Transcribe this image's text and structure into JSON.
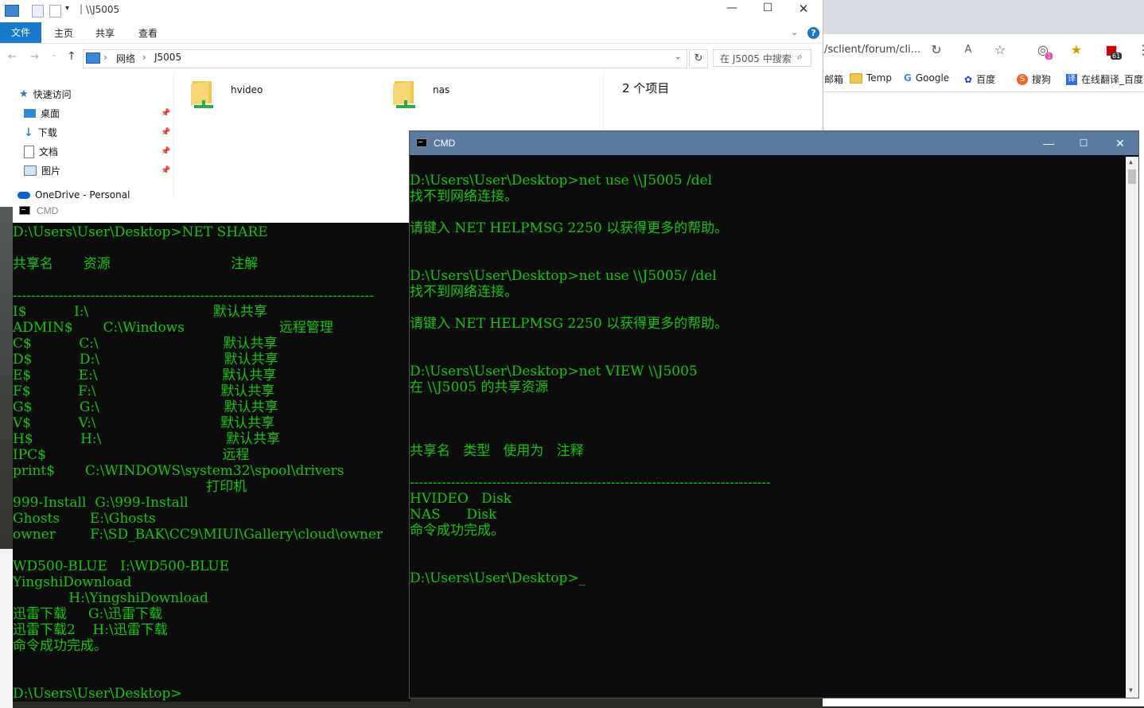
{
  "explorer": {
    "title": "\\\\J5005",
    "ribbon_tabs": [
      "文件",
      "主页",
      "共享",
      "查看"
    ],
    "breadcrumb": [
      "网络",
      "J5005"
    ],
    "search_placeholder": "在 J5005 中搜索",
    "sidebar": {
      "quick_access": "快速访问",
      "items": [
        "桌面",
        "下载",
        "文档",
        "图片"
      ],
      "onedrive": "OneDrive - Personal"
    },
    "folders": [
      "hvideo",
      "nas"
    ],
    "item_count": "2 个项目"
  },
  "browser": {
    "url": "/sclient/forum/cli...",
    "bookmarks": [
      "邮箱",
      "Temp",
      "Google",
      "百度",
      "搜狗",
      "在线翻译_百度"
    ],
    "badge_1": "1",
    "badge_2": "61"
  },
  "cmd_left": {
    "title": "CMD",
    "lines": [
      "D:\\Users\\User\\Desktop>NET SHARE",
      "",
      "共享名       资源                            注解",
      "",
      "-------------------------------------------------------------------------------",
      "I$           I:\\                             默认共享",
      "ADMIN$       C:\\Windows                      远程管理",
      "C$           C:\\                             默认共享",
      "D$           D:\\                             默认共享",
      "E$           E:\\                             默认共享",
      "F$           F:\\                             默认共享",
      "G$           G:\\                             默认共享",
      "V$           V:\\                             默认共享",
      "H$           H:\\                             默认共享",
      "IPC$                                         远程",
      "print$       C:\\WINDOWS\\system32\\spool\\drivers",
      "                                             打印机",
      "999-Install  G:\\999-Install",
      "Ghosts       E:\\Ghosts",
      "owner        F:\\SD_BAK\\CC9\\MIUI\\Gallery\\cloud\\owner",
      "",
      "WD500-BLUE   I:\\WD500-BLUE",
      "YingshiDownload",
      "             H:\\YingshiDownload",
      "迅雷下载     G:\\迅雷下载",
      "迅雷下载2    H:\\迅雷下载",
      "命令成功完成。",
      "",
      "",
      "D:\\Users\\User\\Desktop>"
    ]
  },
  "cmd_right": {
    "title": "CMD",
    "lines": [
      "",
      "D:\\Users\\User\\Desktop>net use \\\\J5005 /del",
      "找不到网络连接。",
      "",
      "请键入 NET HELPMSG 2250 以获得更多的帮助。",
      "",
      "",
      "D:\\Users\\User\\Desktop>net use \\\\J5005/ /del",
      "找不到网络连接。",
      "",
      "请键入 NET HELPMSG 2250 以获得更多的帮助。",
      "",
      "",
      "D:\\Users\\User\\Desktop>net VIEW \\\\J5005",
      "在 \\\\J5005 的共享资源",
      "",
      "",
      "",
      "共享名   类型   使用为   注释",
      "",
      "-------------------------------------------------------------------------------",
      "HVIDEO   Disk",
      "NAS      Disk",
      "命令成功完成。",
      "",
      "",
      "D:\\Users\\User\\Desktop>_"
    ]
  },
  "colors": {
    "console_bg": "#0c0c0c",
    "console_text": "#16c60c",
    "ribbon_file": "#1979ca"
  }
}
